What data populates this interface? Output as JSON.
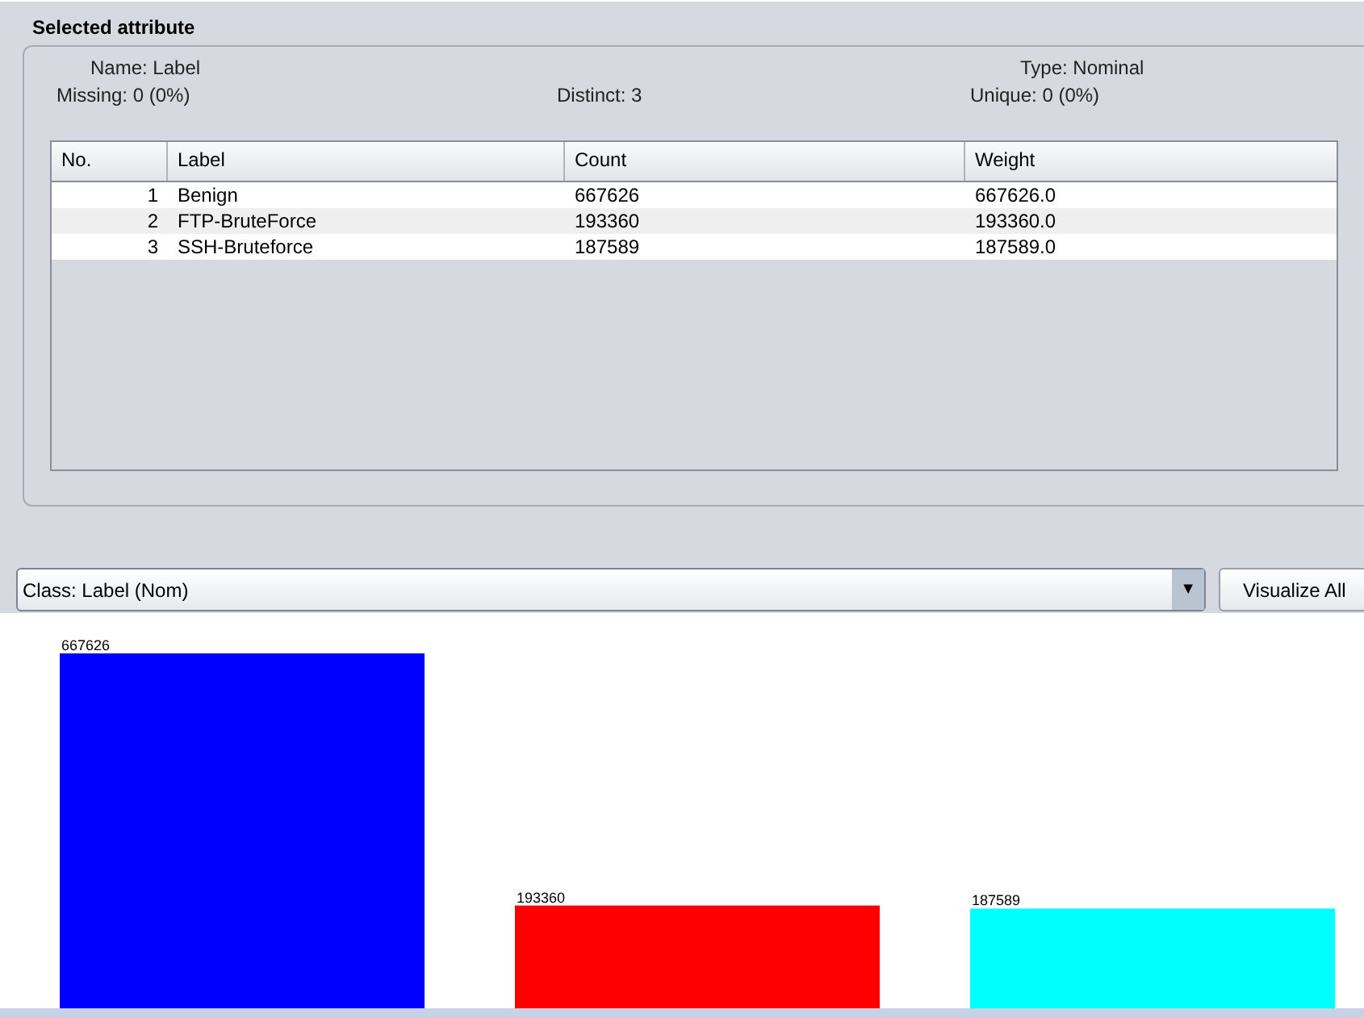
{
  "section_title": "Selected attribute",
  "summary": {
    "name": "Name: Label",
    "type": "Type: Nominal",
    "missing": "Missing: 0 (0%)",
    "distinct": "Distinct: 3",
    "unique": "Unique: 0 (0%)"
  },
  "table": {
    "columns": [
      "No.",
      "Label",
      "Count",
      "Weight"
    ],
    "rows": [
      [
        "1",
        "Benign",
        "667626",
        "667626.0"
      ],
      [
        "2",
        "FTP-BruteForce",
        "193360",
        "193360.0"
      ],
      [
        "3",
        "SSH-Bruteforce",
        "187589",
        "187589.0"
      ]
    ]
  },
  "class_select": {
    "value": "Class: Label (Nom)",
    "arrow": "▼"
  },
  "visualize_button": "Visualize All",
  "chart": {
    "chart_data": {
      "type": "bar",
      "values": [
        667626,
        193360,
        187589
      ],
      "colors": [
        "#0000ff",
        "#ff0000",
        "#00ffff"
      ],
      "data_labels": true
    }
  }
}
